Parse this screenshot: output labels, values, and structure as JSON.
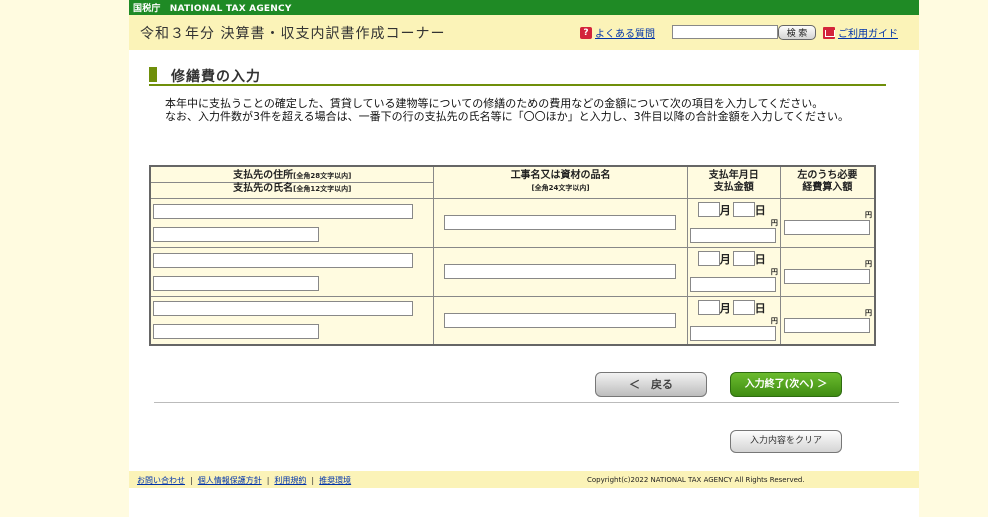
{
  "agency_bar": {
    "text": "国税庁　NATIONAL TAX AGENCY"
  },
  "header": {
    "corner_title": "令和３年分 決算書・収支内訳書作成コーナー",
    "faq_label": "よくある質問",
    "search_button": "検 索",
    "guide_label": "ご利用ガイド"
  },
  "section": {
    "title": "修繕費の入力"
  },
  "description": {
    "line1": "本年中に支払うことの確定した、賃貸している建物等についての修繕のための費用などの金額について次の項目を入力してください。",
    "line2": "なお、入力件数が3件を超える場合は、一番下の行の支払先の氏名等に「〇〇ほか」と入力し、3件目以降の合計金額を入力してください。"
  },
  "table": {
    "col1_line1": "支払先の住所",
    "col1_line1_note": "[全角28文字以内]",
    "col1_line2": "支払先の氏名",
    "col1_line2_note": "[全角12文字以内]",
    "col2": "工事名又は資材の品名",
    "col2_note": "[全角24文字以内]",
    "col3_line1": "支払年月日",
    "col3_line2": "支払金額",
    "col4_line1": "左のうち必要",
    "col4_line2": "経費算入額",
    "month_label": "月",
    "day_label": "日",
    "yen_label": "円"
  },
  "buttons": {
    "back": "＜　戻る",
    "next": "入力終了(次へ) ＞",
    "clear": "入力内容をクリア"
  },
  "footer": {
    "contact": "お問い合わせ",
    "privacy": "個人情報保護方針",
    "terms": "利用規約",
    "env": "推奨環境",
    "copyright": "Copyright(c)2022 NATIONAL TAX AGENCY All Rights Reserved."
  }
}
